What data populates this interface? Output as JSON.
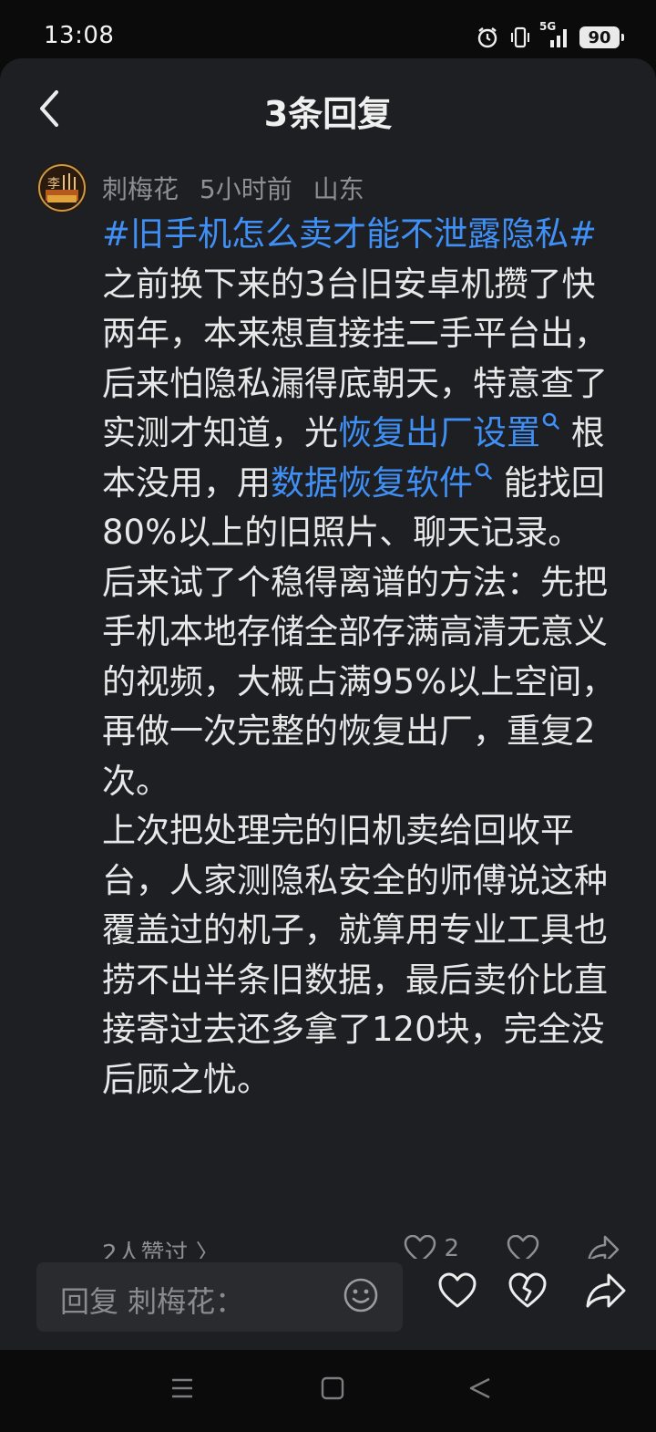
{
  "status_bar": {
    "time": "13:08",
    "network": "5G",
    "battery": "90",
    "icons": [
      "alarm-icon",
      "vibrate-icon",
      "signal-icon",
      "battery-icon"
    ]
  },
  "header": {
    "title": "3条回复",
    "back_icon": "chevron-left-icon"
  },
  "comment": {
    "author": "刺梅花",
    "time": "5小时前",
    "location": "山东",
    "hashtag": "#旧手机怎么卖才能不泄露隐私#",
    "text_1": " 之前换下来的3台旧安卓机攒了快两年，本来想直接挂二手平台出，后来怕隐私漏得底朝天，特意查了实测才知道，光",
    "link_1": "恢复出厂设置",
    "text_2": " 根本没用，用",
    "link_2": "数据恢复软件",
    "text_3": " 能找回80%以上的旧照片、聊天记录。",
    "paragraph_2": "后来试了个稳得离谱的方法：先把手机本地存储全部存满高清无意义的视频，大概占满95%以上空间，再做一次完整的恢复出厂，重复2次。",
    "paragraph_3": "上次把处理完的旧机卖给回收平台，人家测隐私安全的师傅说这种覆盖过的机子，就算用专业工具也捞不出半条旧数据，最后卖价比直接寄过去还多拿了120块，完全没后顾之忧。"
  },
  "action_row": {
    "likes_text": "2人赞过 〉",
    "like_count": "2"
  },
  "bottom_bar": {
    "reply_placeholder": "回复 刺梅花："
  },
  "colors": {
    "background": "#0b0b0c",
    "sheet": "#1e1f22",
    "link": "#3f8ff5",
    "text": "#e8e8e8",
    "muted": "#8e8f93"
  }
}
